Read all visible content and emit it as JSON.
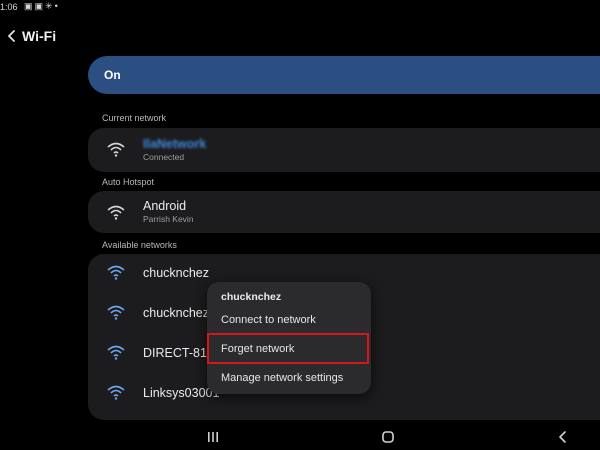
{
  "status_bar": {
    "time": "1:06",
    "icons": [
      "gallery-icon",
      "gallery-icon",
      "settings-icon",
      "dot-icon"
    ]
  },
  "header": {
    "title": "Wi-Fi",
    "back_icon": "back-arrow-icon"
  },
  "master_toggle": {
    "label": "On",
    "accent_color": "#2c4f83"
  },
  "sections": {
    "current_network": "Current network",
    "auto_hotspot": "Auto Hotspot",
    "available_networks": "Available networks"
  },
  "current_network": {
    "name": "IlaNetwork",
    "status": "Connected"
  },
  "auto_hotspot": {
    "name": "Android",
    "subtitle": "Parrish Kevin"
  },
  "available_networks": [
    {
      "name": "chucknchez"
    },
    {
      "name": "chucknchez"
    },
    {
      "name": "DIRECT-81-E"
    },
    {
      "name": "Linksys03001"
    }
  ],
  "context_menu": {
    "title": "chucknchez",
    "items": [
      "Connect to network",
      "Forget network",
      "Manage network settings"
    ],
    "highlight_color": "#d3171c"
  },
  "nav_bar": {
    "icons": [
      "recents-icon",
      "home-icon",
      "back-icon"
    ]
  }
}
